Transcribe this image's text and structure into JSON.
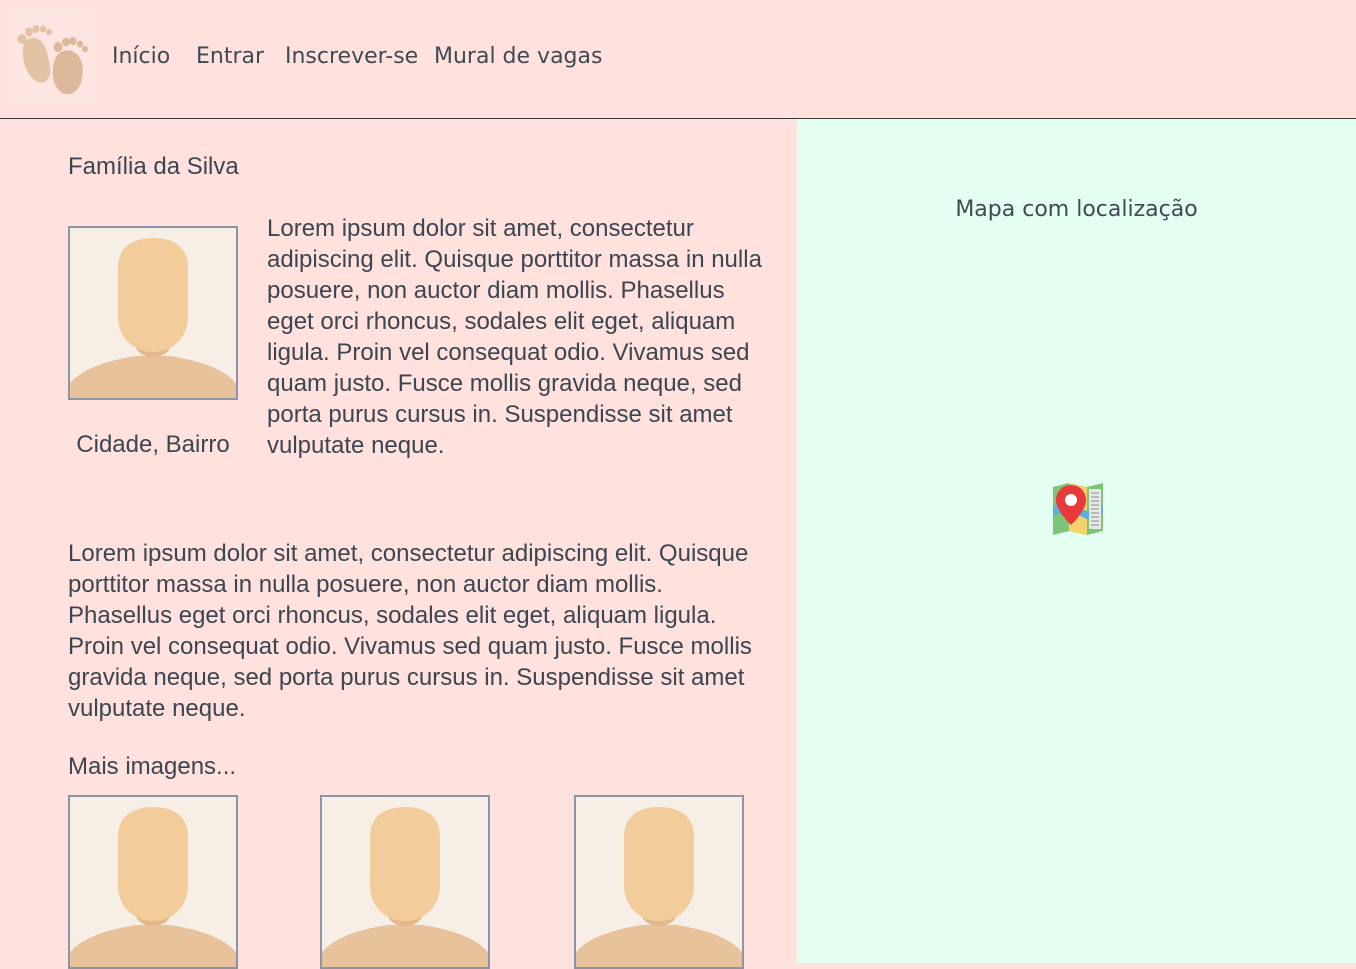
{
  "nav": {
    "links": [
      "Início",
      "Entrar",
      "Inscrever-se",
      "Mural de vagas"
    ]
  },
  "profile": {
    "family_name": "Família da Silva",
    "location": "Cidade, Bairro",
    "description_short": "Lorem ipsum dolor sit amet, consectetur adipiscing elit. Quisque porttitor massa in nulla posuere, non auctor diam mollis. Phasellus eget orci rhoncus, sodales elit eget, aliquam ligula. Proin vel consequat odio. Vivamus sed quam justo. Fusce mollis gravida neque, sed porta purus cursus in. Suspendisse sit amet vulputate neque.",
    "description_long": "Lorem ipsum dolor sit amet, consectetur adipiscing elit. Quisque porttitor massa in nulla posuere, non auctor diam mollis. Phasellus eget orci rhoncus, sodales elit eget, aliquam ligula. Proin vel consequat odio. Vivamus sed quam justo. Fusce mollis gravida neque, sed porta purus cursus in. Suspendisse sit amet vulputate neque.",
    "more_images_label": "Mais imagens..."
  },
  "map": {
    "title": "Mapa com localização"
  },
  "icons": {
    "logo": "baby-feet-icon",
    "avatar": "person-placeholder-icon",
    "map": "map-pin-icon"
  },
  "colors": {
    "page_background": "#ffe1de",
    "map_background": "#e3fff1",
    "text": "#3d4650",
    "photo_border": "#8a96a8",
    "pin": "#e8393b"
  }
}
